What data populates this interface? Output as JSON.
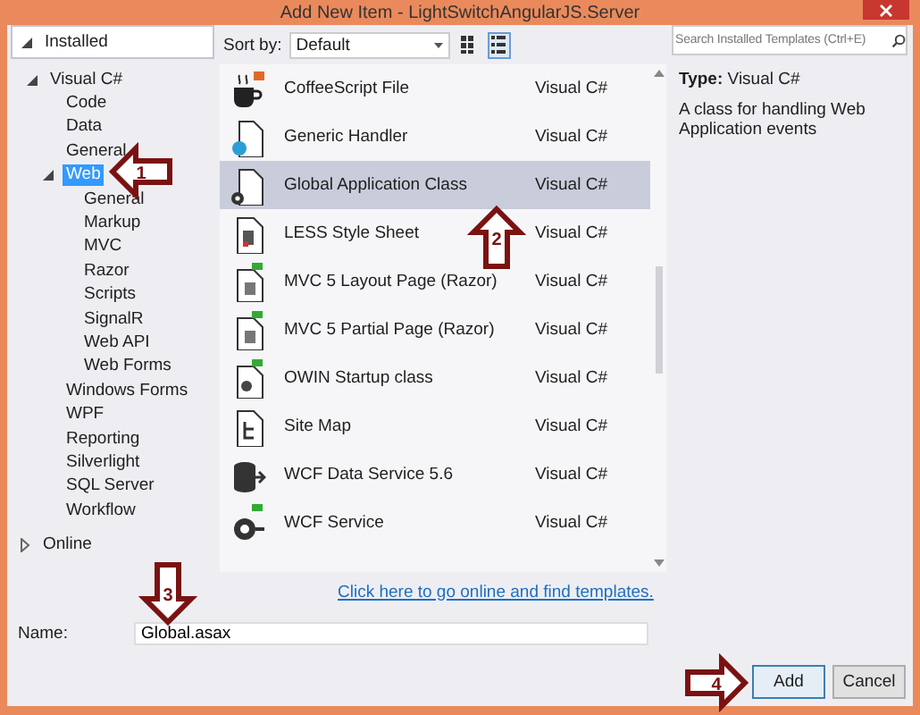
{
  "window": {
    "title": "Add New Item - LightSwitchAngularJS.Server"
  },
  "tree": [
    {
      "label": "Installed",
      "expanded": true,
      "selected": false,
      "children": [
        {
          "label": "Visual C#",
          "expanded": true,
          "selected": false,
          "children": [
            {
              "label": "Code",
              "selected": false
            },
            {
              "label": "Data",
              "selected": false
            },
            {
              "label": "General",
              "selected": false
            },
            {
              "label": "Web",
              "expanded": true,
              "selected": true,
              "children": [
                {
                  "label": "General",
                  "selected": false
                },
                {
                  "label": "Markup",
                  "selected": false
                },
                {
                  "label": "MVC",
                  "selected": false
                },
                {
                  "label": "Razor",
                  "selected": false
                },
                {
                  "label": "Scripts",
                  "selected": false
                },
                {
                  "label": "SignalR",
                  "selected": false
                },
                {
                  "label": "Web API",
                  "selected": false
                },
                {
                  "label": "Web Forms",
                  "selected": false
                }
              ]
            },
            {
              "label": "Windows Forms",
              "selected": false
            },
            {
              "label": "WPF",
              "selected": false
            },
            {
              "label": "Reporting",
              "selected": false
            },
            {
              "label": "Silverlight",
              "selected": false
            },
            {
              "label": "SQL Server",
              "selected": false
            },
            {
              "label": "Workflow",
              "selected": false
            }
          ]
        }
      ]
    },
    {
      "label": "Online",
      "expanded": false,
      "selected": false
    }
  ],
  "sort": {
    "label": "Sort by:",
    "value": "Default"
  },
  "view_buttons": [
    {
      "kind": "grid",
      "selected": false
    },
    {
      "kind": "list",
      "selected": true
    }
  ],
  "search": {
    "placeholder": "Search Installed Templates (Ctrl+E)"
  },
  "templates": [
    {
      "name": "CoffeeScript File",
      "language": "Visual C#",
      "selected": false
    },
    {
      "name": "Generic Handler",
      "language": "Visual C#",
      "selected": false
    },
    {
      "name": "Global Application Class",
      "language": "Visual C#",
      "selected": true
    },
    {
      "name": "LESS Style Sheet",
      "language": "Visual C#",
      "selected": false
    },
    {
      "name": "MVC 5 Layout Page (Razor)",
      "language": "Visual C#",
      "selected": false
    },
    {
      "name": "MVC 5 Partial Page (Razor)",
      "language": "Visual C#",
      "selected": false
    },
    {
      "name": "OWIN Startup class",
      "language": "Visual C#",
      "selected": false
    },
    {
      "name": "Site Map",
      "language": "Visual C#",
      "selected": false
    },
    {
      "name": "WCF Data Service 5.6",
      "language": "Visual C#",
      "selected": false
    },
    {
      "name": "WCF Service",
      "language": "Visual C#",
      "selected": false
    }
  ],
  "online_link": "Click here to go online and find templates.",
  "details": {
    "type_label": "Type:",
    "type_value": "Visual C#",
    "description": "A class for handling Web Application events"
  },
  "name_field": {
    "label": "Name:",
    "value": "Global.asax"
  },
  "buttons": [
    {
      "label": "Add",
      "default": true
    },
    {
      "label": "Cancel",
      "default": false
    }
  ],
  "annotations": [
    {
      "label": "1"
    },
    {
      "label": "2"
    },
    {
      "label": "3"
    },
    {
      "label": "4"
    }
  ]
}
